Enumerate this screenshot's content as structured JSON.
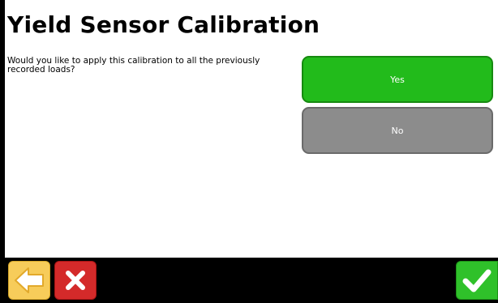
{
  "screen": {
    "title": "Yield Sensor Calibration",
    "question": "Would you like to apply this calibration to all the previously recorded loads?"
  },
  "options": {
    "yes_label": "Yes",
    "no_label": "No"
  },
  "toolbar": {
    "back_icon": "arrow-left-icon",
    "cancel_icon": "close-icon",
    "accept_icon": "checkmark-icon"
  },
  "colors": {
    "yes": "#22bb1b",
    "no": "#8c8c8c",
    "back": "#f7cc5a",
    "cancel": "#d42a2a",
    "accept": "#2fc12a"
  }
}
